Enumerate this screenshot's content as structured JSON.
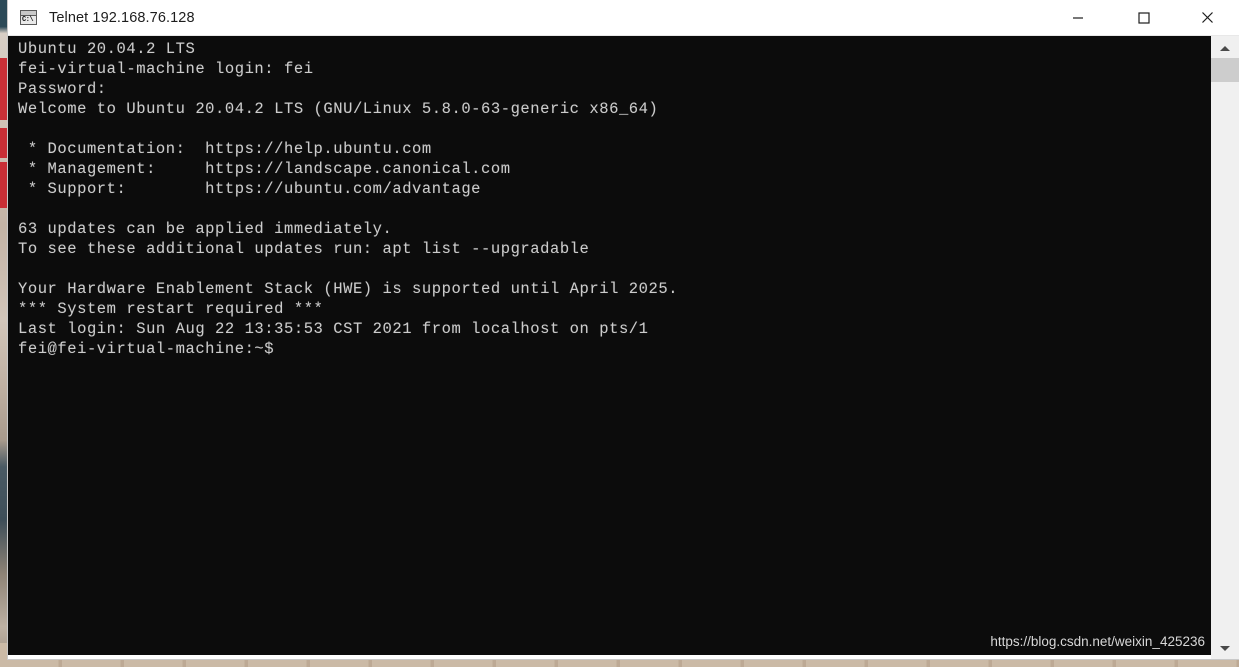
{
  "window": {
    "title": "Telnet 192.168.76.128",
    "icon": "console-icon",
    "controls": {
      "minimize": "Minimize",
      "maximize": "Maximize",
      "close": "Close"
    }
  },
  "terminal": {
    "background_color": "#0c0c0c",
    "text_color": "#cccccc",
    "lines": [
      "Ubuntu 20.04.2 LTS",
      "fei-virtual-machine login: fei",
      "Password:",
      "Welcome to Ubuntu 20.04.2 LTS (GNU/Linux 5.8.0-63-generic x86_64)",
      "",
      " * Documentation:  https://help.ubuntu.com",
      " * Management:     https://landscape.canonical.com",
      " * Support:        https://ubuntu.com/advantage",
      "",
      "63 updates can be applied immediately.",
      "To see these additional updates run: apt list --upgradable",
      "",
      "Your Hardware Enablement Stack (HWE) is supported until April 2025.",
      "*** System restart required ***",
      "Last login: Sun Aug 22 13:35:53 CST 2021 from localhost on pts/1",
      "fei@fei-virtual-machine:~$"
    ]
  },
  "watermark": {
    "text": "https://blog.csdn.net/weixin_425236"
  },
  "scrollbar": {
    "up_arrow": "scroll-up-arrow",
    "down_arrow": "scroll-down-arrow",
    "thumb": "scroll-thumb"
  }
}
